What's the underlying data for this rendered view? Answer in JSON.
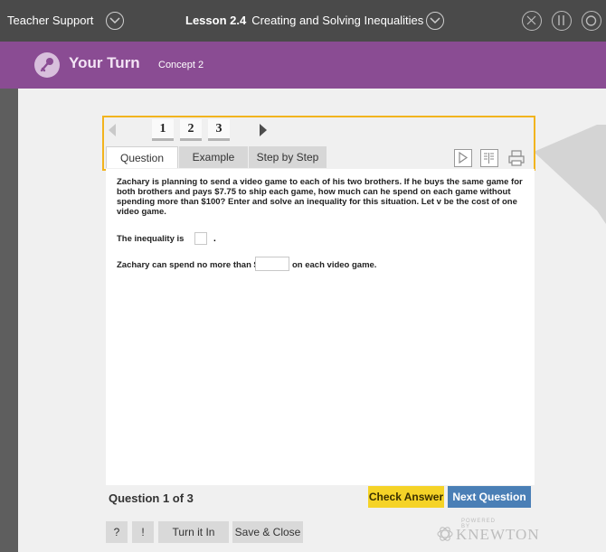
{
  "topbar": {
    "teacher_support": "Teacher Support",
    "lesson_number": "Lesson 2.4",
    "lesson_title": "Creating and Solving Inequalities"
  },
  "header": {
    "title": "Your Turn",
    "subtitle": "Concept 2"
  },
  "pager": {
    "pages": [
      "1",
      "2",
      "3"
    ],
    "current_page": "1"
  },
  "tabs": [
    "Question",
    "Example",
    "Step by Step"
  ],
  "question": {
    "text": "Zachary is planning to send a video game to each of his two brothers. If he buys the same game for both brothers and pays $7.75 to ship each game, how much can he spend on each game without spending more than $100? Enter and solve an inequality for this situation. Let v be the cost of one video game.",
    "inequality_label": "The inequality is",
    "inequality_end": ".",
    "spend_prefix": "Zachary can spend no more than $",
    "spend_suffix": "on each video game."
  },
  "footer": {
    "progress": "Question 1 of 3",
    "check_answer": "Check Answer",
    "next_question": "Next Question"
  },
  "tools": {
    "help": "?",
    "hint": "!",
    "turn_it_in": "Turn it In",
    "save_close": "Save & Close"
  },
  "brand": {
    "powered_by": "POWERED BY",
    "name": "KNEWTON"
  },
  "colors": {
    "purple_header": "#8a4c93",
    "highlight": "#f2b41e",
    "check_button": "#f5d327",
    "next_button": "#4a7fb6"
  }
}
